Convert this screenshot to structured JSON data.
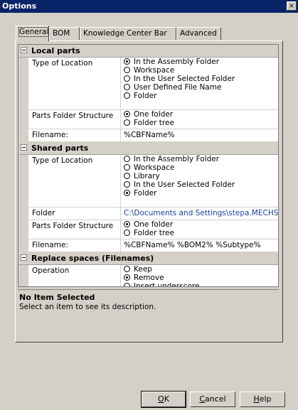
{
  "window": {
    "title": "Options",
    "close_glyph": "×"
  },
  "tabs": [
    "General",
    "BOM",
    "Knowledge Center Bar",
    "Advanced"
  ],
  "local": {
    "header": "Local parts",
    "type_label": "Type of Location",
    "type_options": [
      "In the Assembly Folder",
      "Workspace",
      "In the User Selected Folder",
      "User Defined File Name",
      "Folder"
    ],
    "type_selected": 0,
    "structure_label": "Parts Folder Structure",
    "structure_options": [
      "One folder",
      "Folder tree"
    ],
    "structure_selected": 0,
    "filename_label": "Filename:",
    "filename_value": "%CBFName%"
  },
  "shared": {
    "header": "Shared parts",
    "type_label": "Type of Location",
    "type_options": [
      "In the Assembly Folder",
      "Workspace",
      "Library",
      "In the User Selected Folder",
      "Folder"
    ],
    "type_selected": 4,
    "folder_label": "Folder",
    "folder_value": "C:\\Documents and Settings\\stepa.MECHSOFT\\My D",
    "structure_label": "Parts Folder Structure",
    "structure_options": [
      "One folder",
      "Folder tree"
    ],
    "structure_selected": 0,
    "filename_label": "Filename:",
    "filename_value": "%CBFName% %BOM2% %Subtype%"
  },
  "replace": {
    "header": "Replace spaces (Filenames)",
    "operation_label": "Operation",
    "operation_options": [
      "Keep",
      "Remove",
      "Insert underscore"
    ],
    "operation_selected": 1
  },
  "description": {
    "title": "No Item Selected",
    "text": "Select an item to see its description."
  },
  "buttons": {
    "ok_mnemonic": "O",
    "ok_rest": "K",
    "cancel_mnemonic": "C",
    "cancel_rest": "ancel",
    "help_mnemonic": "H",
    "help_rest": "elp"
  },
  "icons": {
    "close": "close-icon",
    "collapse": "collapse-icon",
    "radio": "radio-icon"
  }
}
